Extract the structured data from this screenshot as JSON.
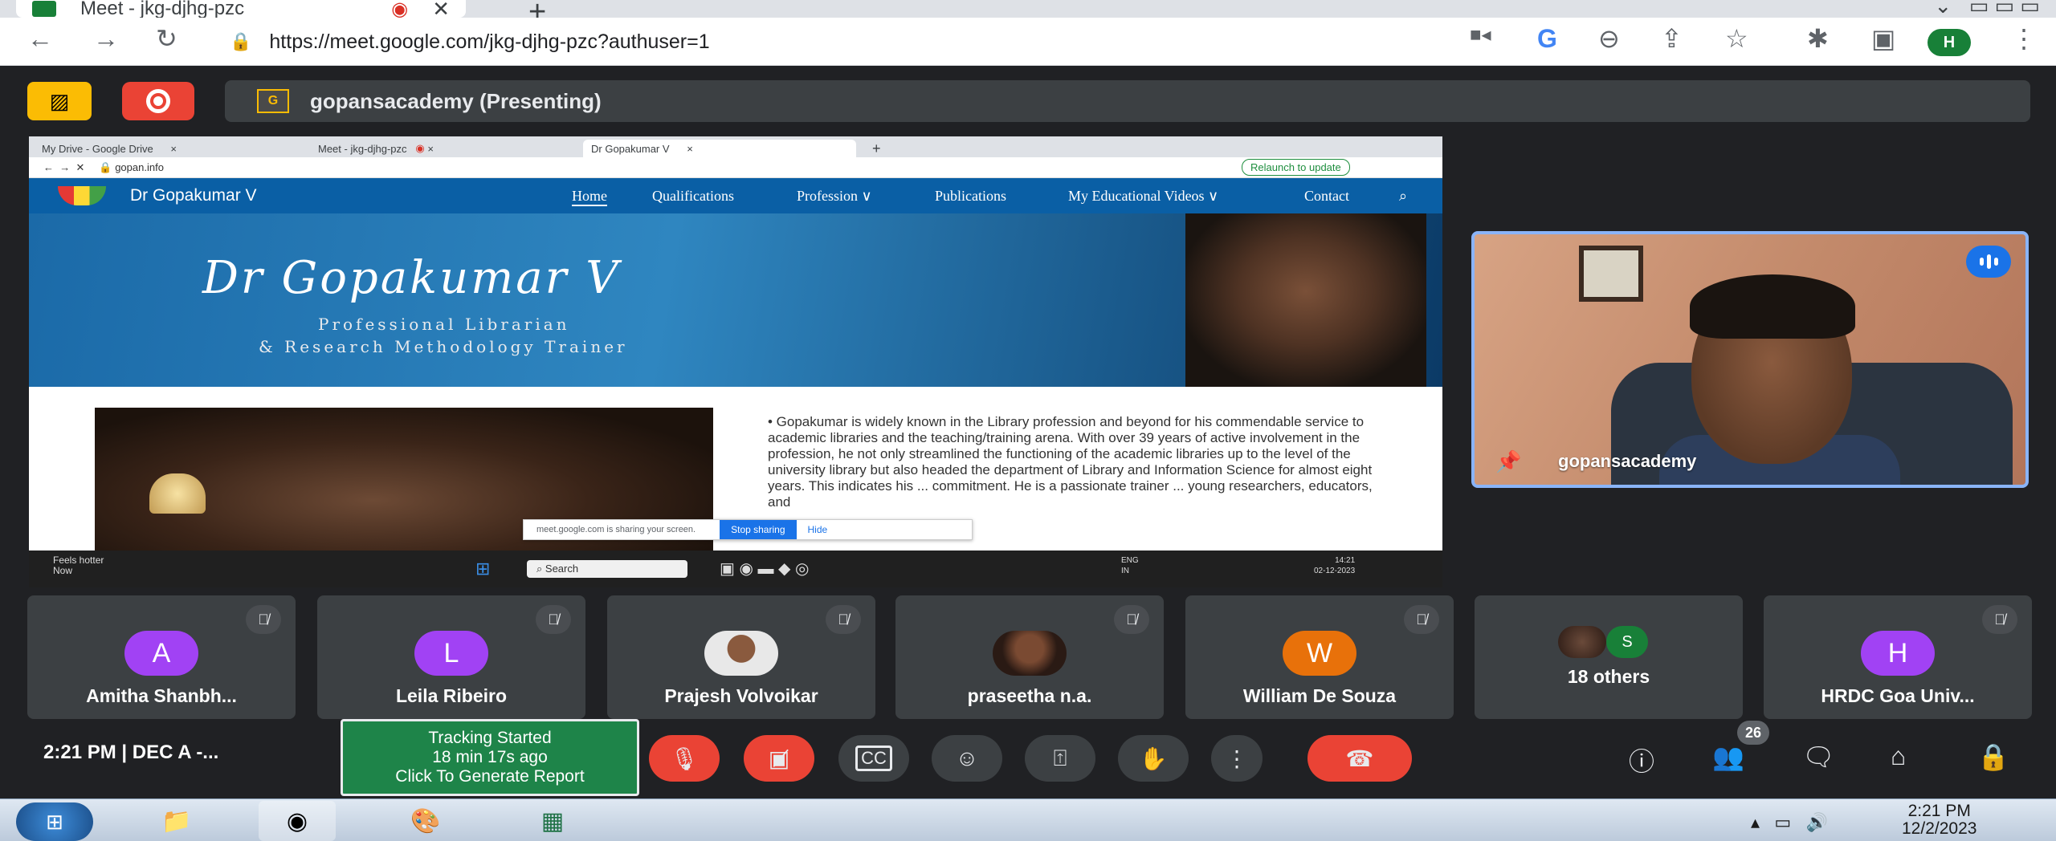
{
  "browser": {
    "tab_title": "Meet - jkg-djhg-pzc",
    "new_tab": "+",
    "url": "https://meet.google.com/jkg-djhg-pzc?authuser=1",
    "profile_initial": "H"
  },
  "meet": {
    "presenter_label": "gopansacademy (Presenting)",
    "presenter_badge": "G",
    "self_name": "gopansacademy",
    "time_label": "2:21 PM  |  DEC A -...",
    "tracker": {
      "line1": "Tracking Started",
      "line2": "18 min 17s ago",
      "line3": "Click To Generate Report"
    },
    "participant_count": "26",
    "participants": [
      {
        "initial": "A",
        "name": "Amitha Shanbh...",
        "color": "#a142f4"
      },
      {
        "initial": "L",
        "name": "Leila Ribeiro",
        "color": "#a142f4"
      },
      {
        "initial": "",
        "name": "Prajesh Volvoikar",
        "color": ""
      },
      {
        "initial": "",
        "name": "praseetha n.a.",
        "color": ""
      },
      {
        "initial": "W",
        "name": "William De Souza",
        "color": "#e8710a"
      },
      {
        "initial": "S",
        "name": "18 others",
        "color": "#188038"
      },
      {
        "initial": "H",
        "name": "HRDC Goa Univ...",
        "color": "#a142f4"
      }
    ],
    "accent_red": "#ea4335",
    "accent_blue": "#8ab4f8"
  },
  "shared": {
    "tabs": [
      "My Drive - Google Drive",
      "Meet - jkg-djhg-pzc",
      "Dr Gopakumar V",
      "+"
    ],
    "address": "gopan.info",
    "relaunch": "Relaunch to update",
    "site_brand": "Dr Gopakumar V",
    "nav": [
      "Home",
      "Qualifications",
      "Profession ∨",
      "Publications",
      "My Educational Videos ∨",
      "Contact"
    ],
    "hero_title": "Dr Gopakumar V",
    "hero_sub1": "Professional Librarian",
    "hero_sub2": "& Research Methodology Trainer",
    "body_text": "• Gopakumar is widely known in the Library profession and beyond for his commendable service to academic libraries and the teaching/training arena. With over 39 years of active involvement in the profession, he not only streamlined the functioning of the academic libraries up to the level of the university library but also headed the department of Library and Information Science for almost eight years. This indicates his ... commitment. He is a passionate trainer ... young researchers, educators, and",
    "sharing_notice": "meet.google.com is sharing your screen.",
    "stop_sharing": "Stop sharing",
    "hide": "Hide",
    "weather1": "Feels hotter",
    "weather2": "Now",
    "search": "Search",
    "lang1": "ENG",
    "lang2": "IN",
    "clock1": "14:21",
    "clock2": "02-12-2023"
  },
  "windows": {
    "clock_time": "2:21 PM",
    "clock_date": "12/2/2023"
  }
}
